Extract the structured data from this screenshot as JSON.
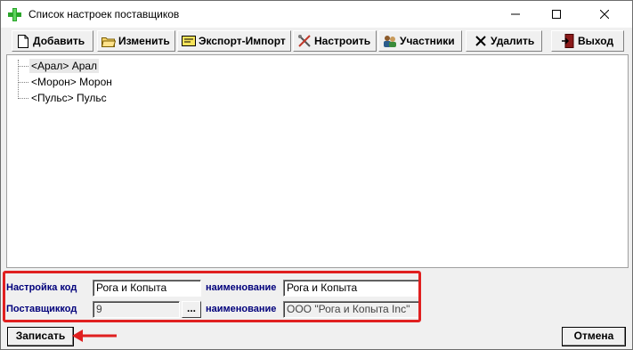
{
  "window": {
    "title": "Список настроек поставщиков",
    "icon": "green-plus-icon"
  },
  "toolbar": {
    "add_label": "Добавить",
    "edit_label": "Изменить",
    "export_label": "Экспорт-Импорт",
    "setup_label": "Настроить",
    "members_label": "Участники",
    "delete_label": "Удалить",
    "exit_label": "Выход"
  },
  "tree": {
    "items": [
      {
        "label": "<Арал> Арал",
        "selected": true
      },
      {
        "label": "<Морон> Морон",
        "selected": false
      },
      {
        "label": "<Пульс> Пульс",
        "selected": false
      }
    ]
  },
  "form": {
    "setting_code_label": "Настройка код",
    "setting_code_value": "Рога и Копыта",
    "setting_name_label": "наименование",
    "setting_name_value": "Рога и Копыта",
    "supplier_code_label": "Поставщиккод",
    "supplier_code_value": "9",
    "browse_label": "...",
    "supplier_name_label": "наименование",
    "supplier_name_value": "ООО \"Рога и Копыта Inc\""
  },
  "buttons": {
    "save_label": "Записать",
    "cancel_label": "Отмена"
  },
  "colors": {
    "highlight": "#e02020",
    "label_text": "#00007b"
  }
}
